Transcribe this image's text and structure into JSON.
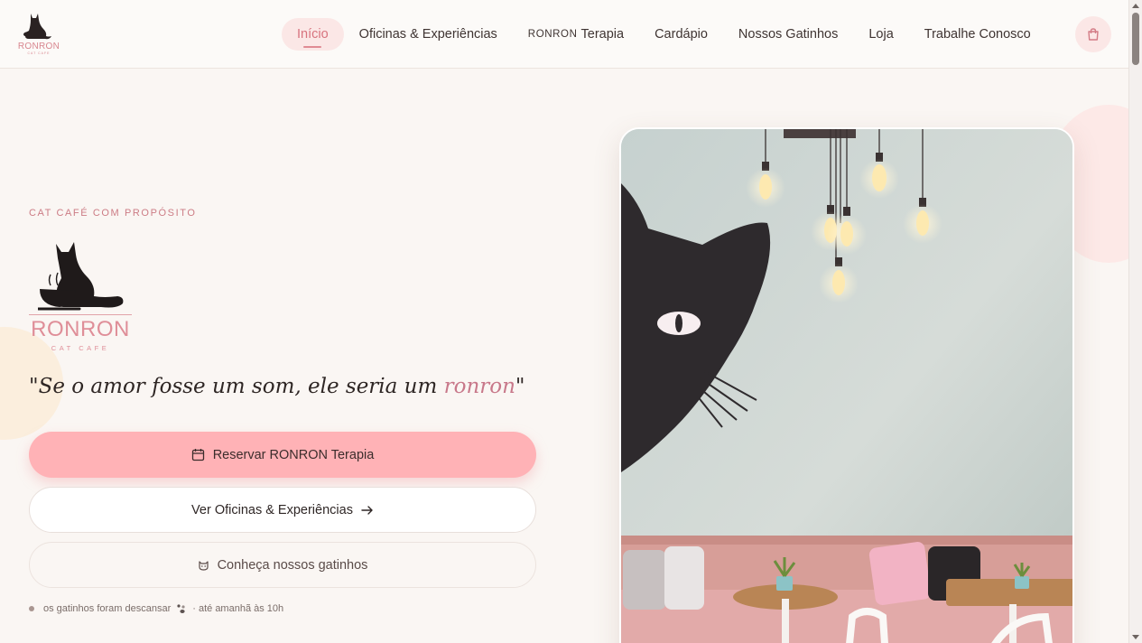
{
  "header": {
    "brand_name": "RONRON",
    "brand_sub": "CAT CAFE",
    "nav": [
      {
        "label": "Início",
        "active": true
      },
      {
        "label": "Oficinas & Experiências"
      },
      {
        "caps": "RONRON",
        "label": "Terapia"
      },
      {
        "label": "Cardápio"
      },
      {
        "label": "Nossos Gatinhos"
      },
      {
        "label": "Loja"
      },
      {
        "label": "Trabalhe Conosco"
      }
    ],
    "cart_icon": "shopping-bag-icon"
  },
  "hero": {
    "eyebrow": "CAT CAFÉ COM PROPÓSITO",
    "logo_word": "RONRON",
    "logo_sub": "CAT CAFE",
    "quote_before": "\"Se o amor fosse um som, ele seria um ",
    "quote_highlight": "ronron",
    "quote_after": "\"",
    "primary_button": "Reservar RONRON Terapia",
    "secondary_button": "Ver Oficinas & Experiências",
    "tertiary_button": "Conheça nossos gatinhos",
    "status_text": "os gatinhos foram descansar",
    "status_suffix": "· até amanhã às 10h"
  },
  "colors": {
    "accent_pink": "#ffb2b6",
    "brand_pink": "#df8e98",
    "background": "#faf6f3"
  }
}
